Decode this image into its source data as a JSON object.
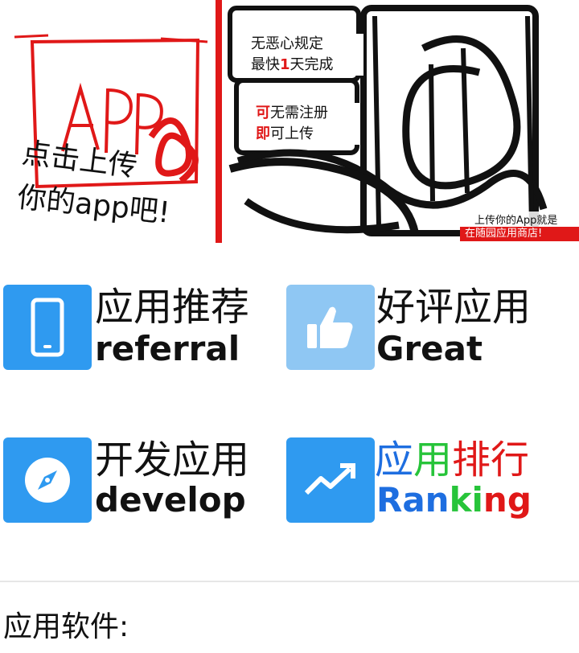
{
  "banner": {
    "left_sketch_text": "APP",
    "handwriting_line1": "点击上传",
    "handwriting_line2": "你的app吧!",
    "promo1_line1": "无恶心规定",
    "promo1_line2_a": "最快",
    "promo1_line2_b": "1",
    "promo1_line2_c": "天完成",
    "promo2_line1_a": "可",
    "promo2_line1_b": "无需注册",
    "promo2_line2_a": "即",
    "promo2_line2_b": "可上传",
    "caption_line1": "上传你的App就是",
    "caption_line2": "在随园应用商店!"
  },
  "tiles": [
    {
      "zh": "应用推荐",
      "en": "referral",
      "icon": "phone-icon",
      "icon_bg": "#2f9af0"
    },
    {
      "zh": "好评应用",
      "en": "Great",
      "icon": "thumbs-up-icon",
      "icon_bg": "#8fc7f3"
    },
    {
      "zh": "开发应用",
      "en": "develop",
      "icon": "compass-icon",
      "icon_bg": "#2f9af0"
    },
    {
      "zh_parts": [
        "应",
        "用",
        "排",
        "行"
      ],
      "en_parts": [
        "Ran",
        "ki",
        "ng"
      ],
      "icon": "trending-up-icon",
      "icon_bg": "#2f9af0"
    }
  ],
  "colors": {
    "accent_blue": "#2f9af0",
    "ranking_blue": "#1e6ee0",
    "ranking_green": "#27c43a",
    "ranking_red": "#e01818"
  },
  "section_title": "应用软件:"
}
